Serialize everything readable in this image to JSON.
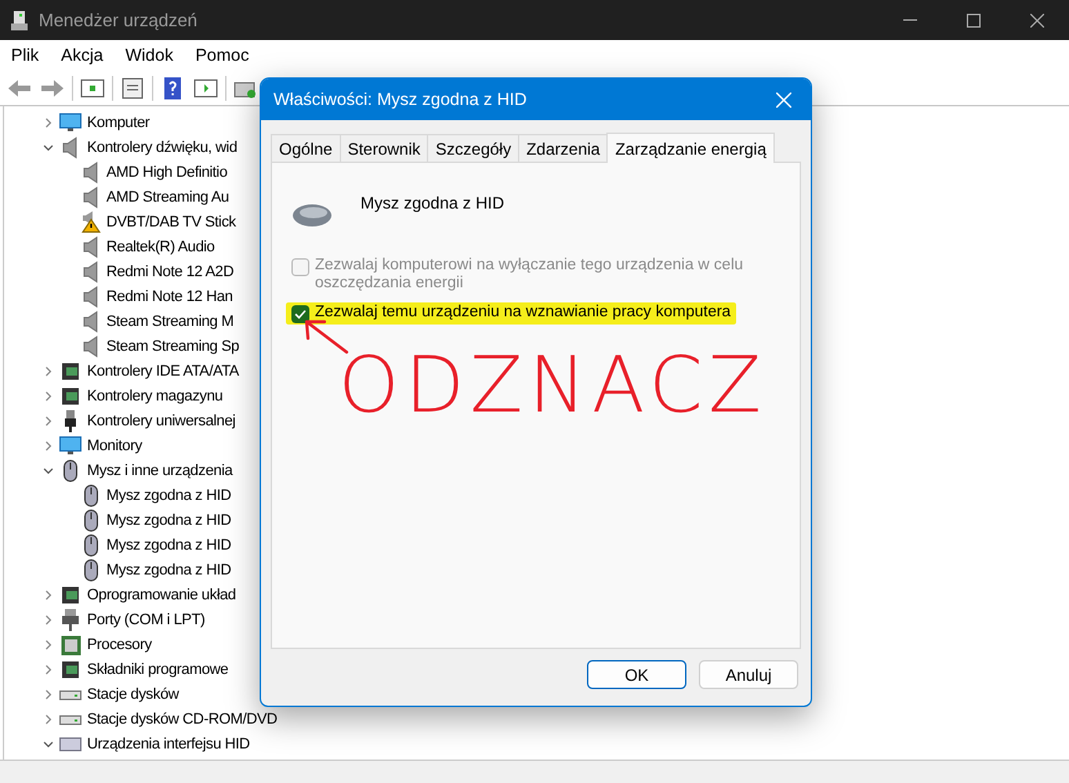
{
  "window": {
    "title": "Menedżer urządzeń"
  },
  "menu": [
    "Plik",
    "Akcja",
    "Widok",
    "Pomoc"
  ],
  "tree": [
    {
      "label": "Komputer",
      "expanded": false
    },
    {
      "label": "Kontrolery dźwięku, wid",
      "expanded": true,
      "children": [
        {
          "label": "AMD High Definitio",
          "warning": false
        },
        {
          "label": "AMD Streaming Au",
          "warning": false
        },
        {
          "label": "DVBT/DAB TV Stick",
          "warning": true
        },
        {
          "label": "Realtek(R) Audio",
          "warning": false
        },
        {
          "label": "Redmi Note 12 A2D",
          "warning": false
        },
        {
          "label": "Redmi Note 12 Han",
          "warning": false
        },
        {
          "label": "Steam Streaming M",
          "warning": false
        },
        {
          "label": "Steam Streaming Sp",
          "warning": false
        }
      ]
    },
    {
      "label": "Kontrolery IDE ATA/ATA",
      "expanded": false
    },
    {
      "label": "Kontrolery magazynu",
      "expanded": false
    },
    {
      "label": "Kontrolery uniwersalnej",
      "expanded": false
    },
    {
      "label": "Monitory",
      "expanded": false
    },
    {
      "label": "Mysz i inne urządzenia",
      "expanded": true,
      "children": [
        {
          "label": "Mysz zgodna z HID",
          "warning": false
        },
        {
          "label": "Mysz zgodna z HID",
          "warning": false
        },
        {
          "label": "Mysz zgodna z HID",
          "warning": false
        },
        {
          "label": "Mysz zgodna z HID",
          "warning": false
        }
      ]
    },
    {
      "label": "Oprogramowanie układ",
      "expanded": false
    },
    {
      "label": "Porty (COM i LPT)",
      "expanded": false
    },
    {
      "label": "Procesory",
      "expanded": false
    },
    {
      "label": "Składniki programowe",
      "expanded": false
    },
    {
      "label": "Stacje dysków",
      "expanded": false
    },
    {
      "label": "Stacje dysków CD-ROM/DVD",
      "expanded": false
    },
    {
      "label": "Urządzenia interfejsu HID",
      "expanded": true
    }
  ],
  "dialog": {
    "title": "Właściwości: Mysz zgodna z HID",
    "tabs": [
      {
        "label": "Ogólne",
        "selected": false
      },
      {
        "label": "Sterownik",
        "selected": false
      },
      {
        "label": "Szczegóły",
        "selected": false
      },
      {
        "label": "Zdarzenia",
        "selected": false
      },
      {
        "label": "Zarządzanie energią",
        "selected": true
      }
    ],
    "device_name": "Mysz zgodna z HID",
    "options": [
      {
        "label": "Zezwalaj komputerowi na wyłączanie tego urządzenia w celu oszczędzania energii",
        "checked": false,
        "disabled": true,
        "highlighted": false
      },
      {
        "label": "Zezwalaj temu urządzeniu na wznawianie pracy komputera",
        "checked": true,
        "disabled": false,
        "highlighted": true
      }
    ],
    "buttons": [
      {
        "label": "OK",
        "default": true
      },
      {
        "label": "Anuluj",
        "default": false
      }
    ]
  },
  "annotation": {
    "text": "ODZNACZ"
  }
}
